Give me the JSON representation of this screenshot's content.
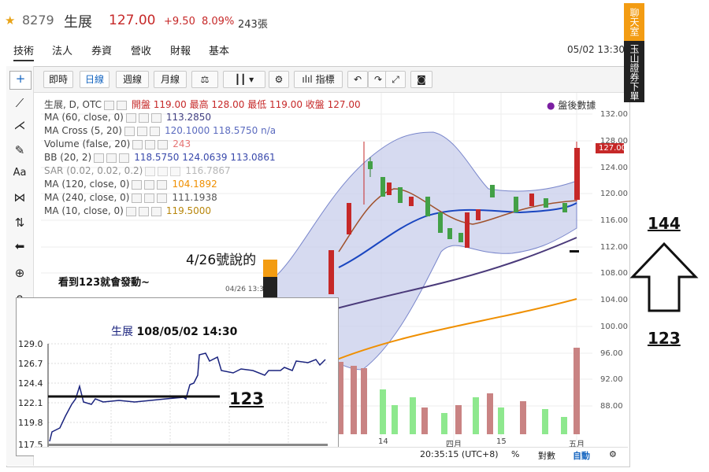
{
  "header": {
    "code": "8279",
    "name": "生展",
    "price": "127.00",
    "change": "+9.50",
    "percent": "8.09%",
    "volume": "243張"
  },
  "tabs": [
    "技術",
    "法人",
    "券資",
    "營收",
    "財報",
    "基本"
  ],
  "datetime": "05/02 13:30",
  "toolbar": {
    "buttons": [
      "即時",
      "日線",
      "週線",
      "月線",
      "指標"
    ]
  },
  "legend": [
    {
      "name": "生展, D, OTC",
      "vals": "開盤 119.00 最高 128.00 最低 119.00 收盤 127.00",
      "color": "#c62828"
    },
    {
      "name": "MA (60, close, 0)",
      "vals": "113.2850",
      "color": "#3f3d80"
    },
    {
      "name": "MA Cross (5, 20)",
      "vals": "120.1000  118.5750  n/a",
      "color": "#5b6bbf"
    },
    {
      "name": "Volume (false, 20)",
      "vals": "243",
      "color": "#e57373"
    },
    {
      "name": "BB (20, 2)",
      "vals": "118.5750  124.0639  113.0861",
      "color": "#3949ab"
    },
    {
      "name": "SAR (0.02, 0.02, 0.2)",
      "vals": "116.7867",
      "color": "#aaaaaa"
    },
    {
      "name": "MA (120, close, 0)",
      "vals": "104.1892",
      "color": "#ef8f00"
    },
    {
      "name": "MA (240, close, 0)",
      "vals": "111.1938",
      "color": "#555555"
    },
    {
      "name": "MA (10, close, 0)",
      "vals": "119.5000",
      "color": "#b8860b"
    }
  ],
  "after_hours": "盤後數據",
  "price_axis": [
    "132.00",
    "128.00",
    "124.00",
    "120.00",
    "116.00",
    "112.00",
    "108.00",
    "104.00",
    "100.00",
    "96.00",
    "92.00",
    "88.00"
  ],
  "last_price_tag": "127.00",
  "x_axis": [
    "14",
    "四月",
    "15",
    "五月"
  ],
  "banner": {
    "top": "聊天室",
    "bottom": "玉山證券下單"
  },
  "notes": {
    "n426": "4/26號說的",
    "n123": "看到123就會發動~",
    "stamp": "04/26 13:30"
  },
  "arrow_labels": {
    "top": "144",
    "bottom": "123"
  },
  "inset": {
    "title_name": "生展",
    "title_time": "108/05/02 14:30",
    "y": [
      "129.0",
      "126.7",
      "124.4",
      "122.1",
      "119.8",
      "117.5"
    ],
    "label": "123"
  },
  "bottom_bar": {
    "time": "20:35:15 (UTC+8)",
    "pct": "%",
    "log": "對數",
    "auto": "自動"
  }
}
